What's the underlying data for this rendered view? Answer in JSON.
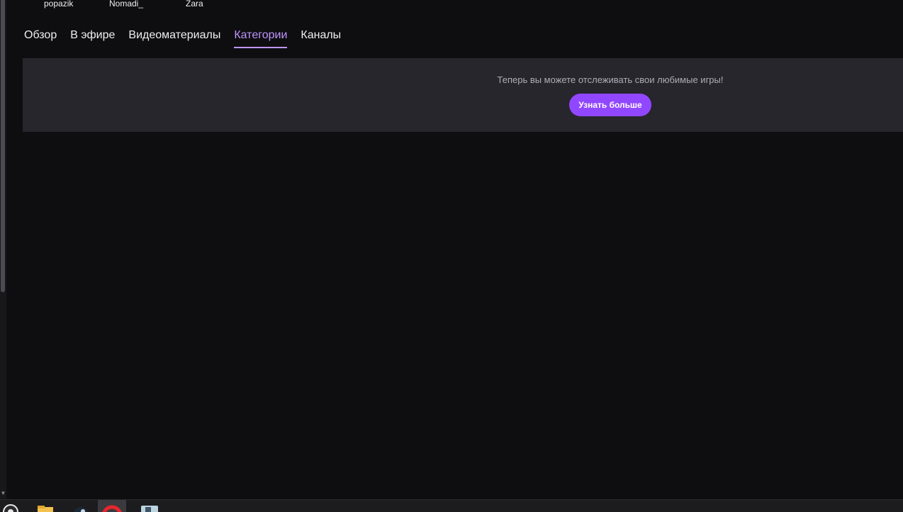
{
  "channels": [
    "popazik",
    "Nomadi_",
    "Zara"
  ],
  "tabs": [
    {
      "label": "Обзор",
      "active": false
    },
    {
      "label": "В эфире",
      "active": false
    },
    {
      "label": "Видеоматериалы",
      "active": false
    },
    {
      "label": "Категории",
      "active": true
    },
    {
      "label": "Каналы",
      "active": false
    }
  ],
  "banner": {
    "message": "Теперь вы можете отслеживать свои любимые игры!",
    "button_label": "Узнать больше"
  },
  "colors": {
    "accent": "#9147ff",
    "active_tab": "#bf94ff",
    "background": "#0e0e10",
    "banner_bg": "#27262c"
  },
  "taskbar": {
    "icons": [
      "obs-icon",
      "folder-icon",
      "steam-icon",
      "opera-icon",
      "app-icon"
    ]
  }
}
